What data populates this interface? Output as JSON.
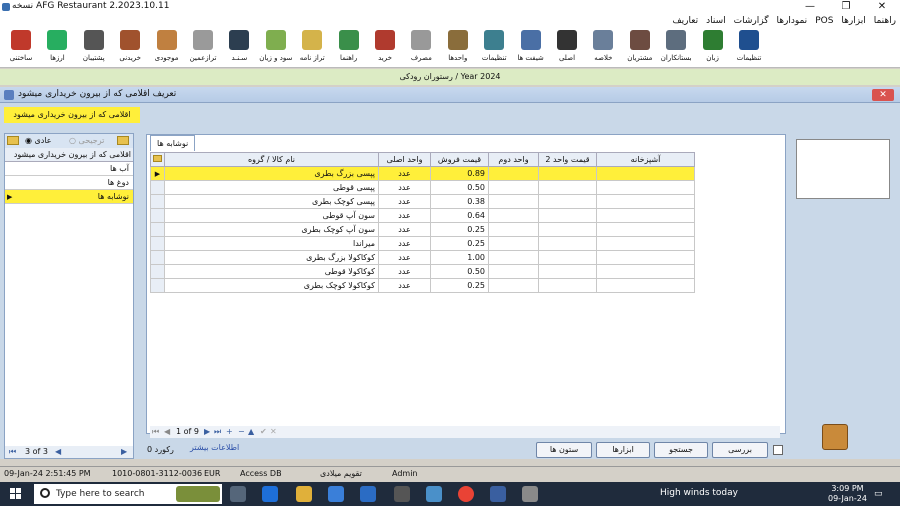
{
  "app": {
    "title": "نسخه AFG Restaurant 2.2023.10.11"
  },
  "menu": [
    "تعاریف",
    "اسناد",
    "گزارشات",
    "نمودارها",
    "POS",
    "ابزارها",
    "راهنما"
  ],
  "toolbar": [
    {
      "label": "ساختنی",
      "color": "#c0392b"
    },
    {
      "label": "ارزها",
      "color": "#27ae60"
    },
    {
      "label": "پشتیبان",
      "color": "#555555"
    },
    {
      "label": "خریدنی",
      "color": "#a0522d"
    },
    {
      "label": "موجودی",
      "color": "#c08040"
    },
    {
      "label": "ترازعمین",
      "color": "#9a9a9a"
    },
    {
      "label": "سـنـد",
      "color": "#2c3e50"
    },
    {
      "label": "سود و زیان",
      "color": "#7fae4f"
    },
    {
      "label": "تراز نامه",
      "color": "#d4b34a"
    },
    {
      "label": "راهنما",
      "color": "#3a8f4a"
    },
    {
      "label": "خرید",
      "color": "#b03a2e"
    },
    {
      "label": "مصرف",
      "color": "#999999"
    },
    {
      "label": "واحدها",
      "color": "#8a6d3b"
    },
    {
      "label": "تنظیمات",
      "color": "#3d7f8f"
    },
    {
      "label": "شیفت ها",
      "color": "#4a6fa5"
    },
    {
      "label": "اصلی",
      "color": "#333333"
    },
    {
      "label": "خلاصه",
      "color": "#6a7f9a"
    },
    {
      "label": "مشتریان",
      "color": "#6d4c41"
    },
    {
      "label": "بستانکاران",
      "color": "#5d6d7e"
    },
    {
      "label": "زبان",
      "color": "#2e7d32"
    },
    {
      "label": "تنظیمات",
      "color": "#1f4f8f"
    }
  ],
  "year_bar": "رستوران رودکی / Year 2024",
  "window": {
    "title": "تعریف اقلامی که از بیرون خریداری میشود",
    "close": "✕",
    "header": "اقلامی که از بیرون خریداری میشود"
  },
  "left_panel": {
    "radio_normal": "عادی",
    "radio_wholesale": "ترجیحی",
    "header": "اقلامی که از بیرون خریداری میشود",
    "items": [
      "آب ها",
      "دوغ ها",
      "نوشابه ها"
    ],
    "selected_index": 2,
    "footer": "3 of 3"
  },
  "tab_label": "نوشابه ها",
  "grid": {
    "columns": [
      "نام کالا / گروه",
      "واحد اصلی",
      "قیمت فروش",
      "واحد دوم",
      "قیمت واحد 2",
      "آشپزخانه"
    ],
    "rows": [
      {
        "name": "پپسی بزرگ بطری",
        "unit": "عدد",
        "price": "0.89"
      },
      {
        "name": "پپسی قوطی",
        "unit": "عدد",
        "price": "0.50"
      },
      {
        "name": "پپسی کوچک بطری",
        "unit": "عدد",
        "price": "0.38"
      },
      {
        "name": "سون آپ قوطی",
        "unit": "عدد",
        "price": "0.64"
      },
      {
        "name": "سون آپ کوچک بطری",
        "unit": "عدد",
        "price": "0.25"
      },
      {
        "name": "میراندا",
        "unit": "عدد",
        "price": "0.25"
      },
      {
        "name": "کوکاکولا بزرگ بطری",
        "unit": "عدد",
        "price": "1.00"
      },
      {
        "name": "کوکاکولا قوطی",
        "unit": "عدد",
        "price": "0.50"
      },
      {
        "name": "کوکاکولا کوچک بطری",
        "unit": "عدد",
        "price": "0.25"
      }
    ],
    "selected_index": 0,
    "pager": "1 of 9"
  },
  "bottom": {
    "records": "رکورد 0",
    "info_link": "اطلاعات بیشتر",
    "btn_columns": "ستون ها",
    "btn_tools": "ابزارها",
    "btn_search": "جستجو",
    "btn_review": "بررسی"
  },
  "status": {
    "datetime": "09-Jan-24 2:51:45 PM",
    "code": "1010-0801-3112-0036",
    "currency": "EUR",
    "db": "Access DB",
    "calendar": "تقویم میلادی",
    "user": "Admin"
  },
  "taskbar": {
    "search_placeholder": "Type here to search",
    "weather": "High winds today",
    "time": "3:09 PM",
    "date": "09-Jan-24"
  }
}
